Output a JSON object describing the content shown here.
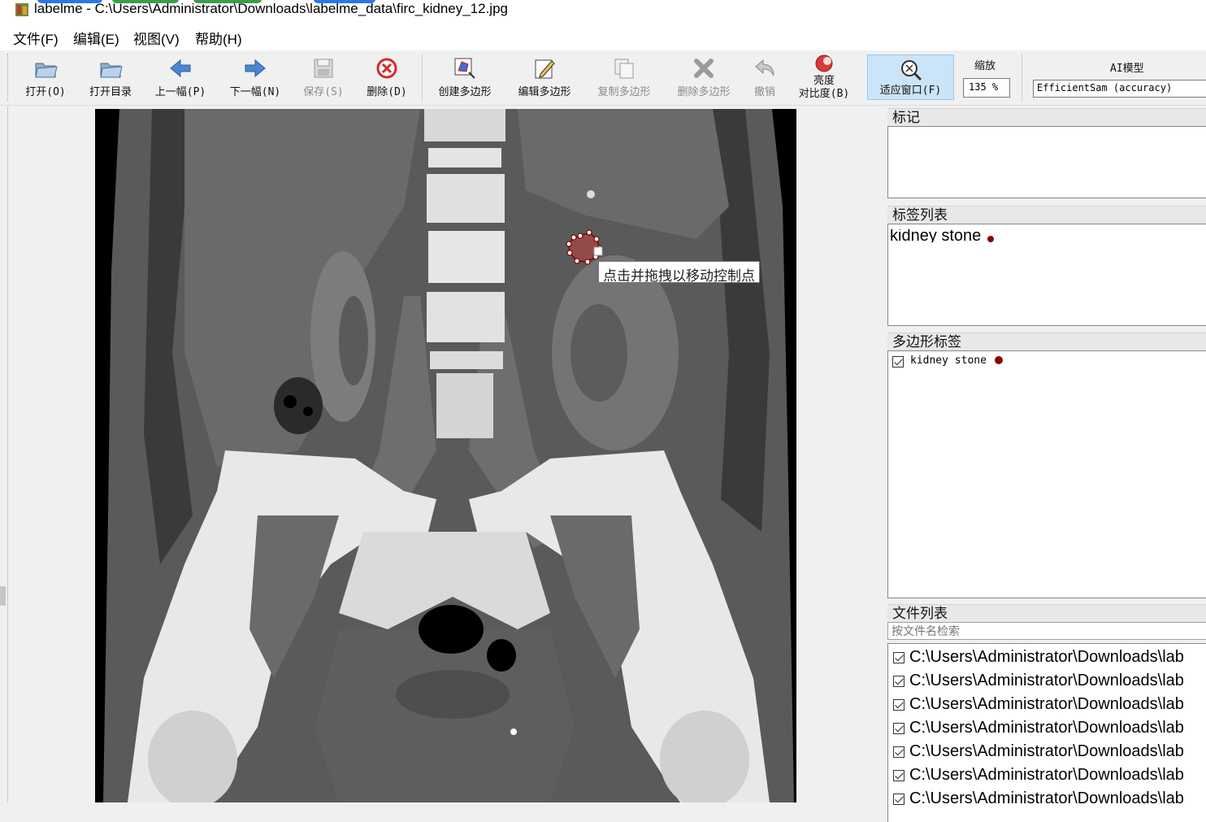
{
  "window": {
    "title": "labelme - C:\\Users\\Administrator\\Downloads\\labelme_data\\firc_kidney_12.jpg"
  },
  "menu": {
    "file": "文件(F)",
    "edit": "编辑(E)",
    "view": "视图(V)",
    "help": "帮助(H)"
  },
  "toolbar": {
    "open": "打开(O)",
    "open_dir": "打开目录",
    "prev": "上一幅(P)",
    "next": "下一幅(N)",
    "save": "保存(S)",
    "delete": "删除(D)",
    "create_polygon": "创建多边形",
    "edit_polygon": "编辑多边形",
    "copy_polygon": "复制多边形",
    "delete_polygon": "删除多边形",
    "undo": "撤销",
    "brightness_line1": "亮度",
    "brightness_line2": "对比度(B)",
    "fit_window": "适应窗口(F)",
    "zoom_label": "缩放",
    "zoom_value": "135 %",
    "ai_label": "AI模型",
    "ai_model": "EfficientSam (accuracy)"
  },
  "canvas": {
    "tooltip": "点击并拖拽以移动控制点"
  },
  "panels": {
    "flags_title": "标记",
    "labels_title": "标签列表",
    "label_items": [
      {
        "text": "kidney stone",
        "color": "#8b0000"
      }
    ],
    "polygons_title": "多边形标签",
    "polygon_items": [
      {
        "text": "kidney stone",
        "color": "#8b0000",
        "checked": true
      }
    ],
    "files_title": "文件列表",
    "search_placeholder": "按文件名检索",
    "files": [
      "C:\\Users\\Administrator\\Downloads\\lab",
      "C:\\Users\\Administrator\\Downloads\\lab",
      "C:\\Users\\Administrator\\Downloads\\lab",
      "C:\\Users\\Administrator\\Downloads\\lab",
      "C:\\Users\\Administrator\\Downloads\\lab",
      "C:\\Users\\Administrator\\Downloads\\lab",
      "C:\\Users\\Administrator\\Downloads\\lab"
    ]
  }
}
